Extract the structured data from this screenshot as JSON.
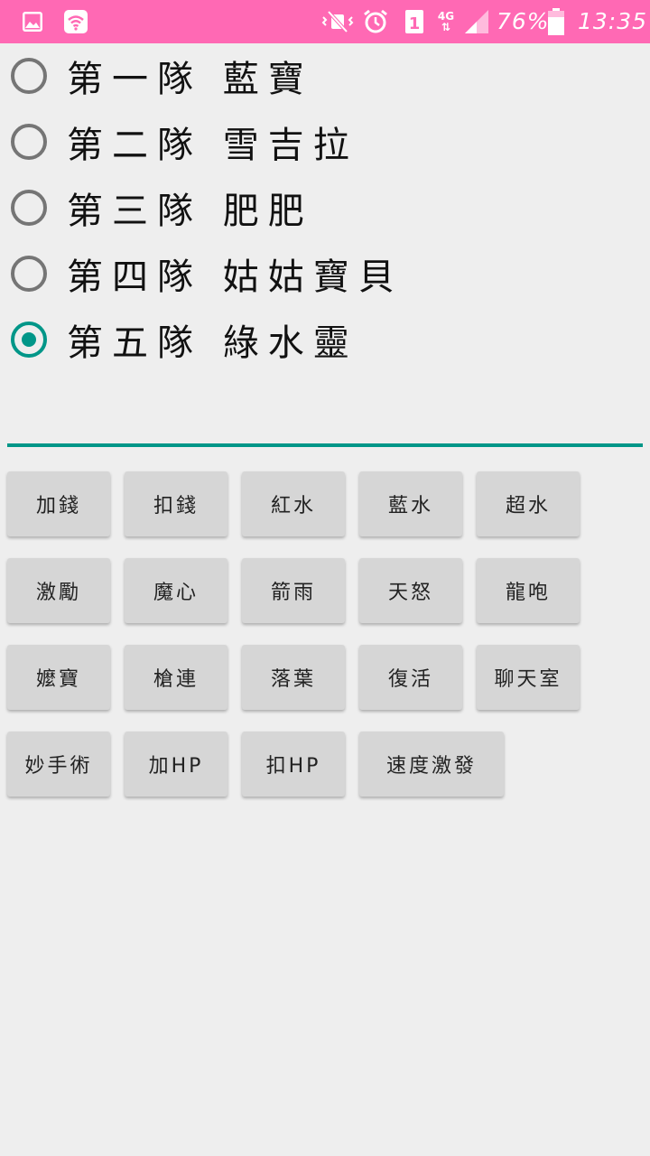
{
  "status_bar": {
    "battery_percent": "76%",
    "time": "13:35",
    "sim_slot": "1",
    "network_type": "4G",
    "icons": [
      "gallery-icon",
      "wifi-icon",
      "vibrate-icon",
      "alarm-icon",
      "sim-icon",
      "network-4g-icon",
      "signal-icon",
      "battery-icon"
    ],
    "background_color": "#ff69b4"
  },
  "teams": {
    "selected_index": 4,
    "items": [
      {
        "label": "第一隊 藍寶",
        "checked": false
      },
      {
        "label": "第二隊 雪吉拉",
        "checked": false
      },
      {
        "label": "第三隊 肥肥",
        "checked": false
      },
      {
        "label": "第四隊 姑姑寶貝",
        "checked": false
      },
      {
        "label": "第五隊 綠水靈",
        "checked": true
      }
    ]
  },
  "input": {
    "value": "",
    "accent_color": "#009688"
  },
  "buttons": [
    {
      "label": "加錢"
    },
    {
      "label": "扣錢"
    },
    {
      "label": "紅水"
    },
    {
      "label": "藍水"
    },
    {
      "label": "超水"
    },
    {
      "label": "激勵"
    },
    {
      "label": "魔心"
    },
    {
      "label": "箭雨"
    },
    {
      "label": "天怒"
    },
    {
      "label": "龍咆"
    },
    {
      "label": "嬤寶"
    },
    {
      "label": "槍連"
    },
    {
      "label": "落葉"
    },
    {
      "label": "復活"
    },
    {
      "label": "聊天室"
    },
    {
      "label": "妙手術"
    },
    {
      "label": "加HP"
    },
    {
      "label": "扣HP"
    },
    {
      "label": "速度激發"
    }
  ]
}
